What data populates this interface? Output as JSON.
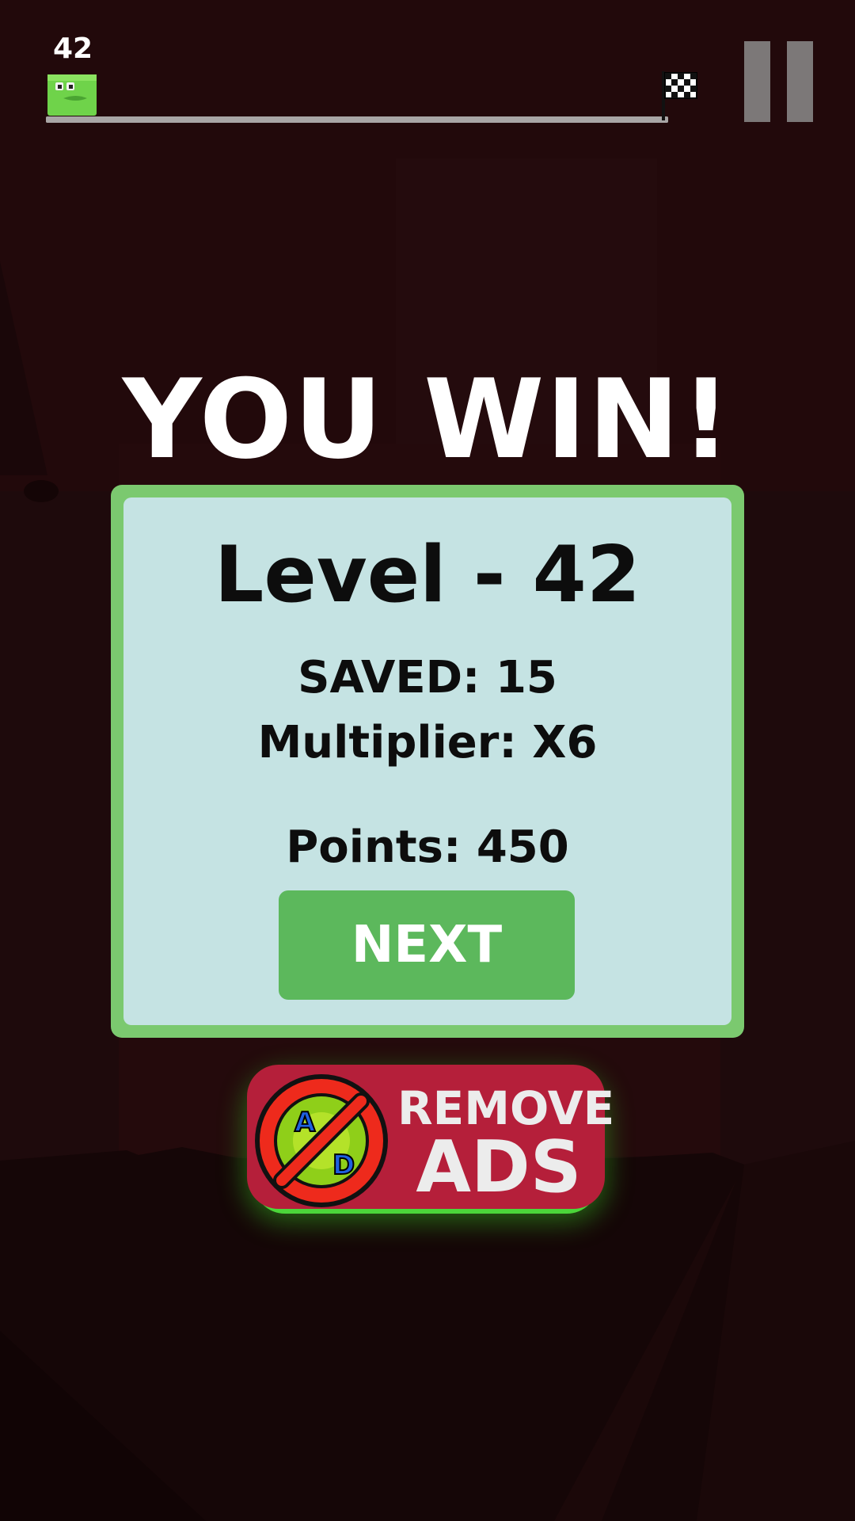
{
  "hud": {
    "current_level": "42",
    "progress": 1.0
  },
  "win": {
    "title": "YOU WIN!"
  },
  "results": {
    "level": "Level - 42",
    "saved": "SAVED: 15",
    "multiplier": "Multiplier: X6",
    "points": "Points: 450",
    "next_label": "NEXT"
  },
  "remove_ads": {
    "line1": "REMOVE",
    "line2": "ADS",
    "icon_letter_1": "A",
    "icon_letter_2": "D"
  },
  "colors": {
    "background": "#1e0a0c",
    "panel_border": "#7bc96f",
    "panel_fill": "#c5e3e3",
    "next_button": "#5cb85c",
    "remove_ads": "#b51f3a",
    "glow": "#4bd63a"
  },
  "icons": {
    "player": "green-block-character-icon",
    "finish": "checkered-flag-icon",
    "pause": "pause-icon",
    "no_ads": "no-ads-icon"
  }
}
